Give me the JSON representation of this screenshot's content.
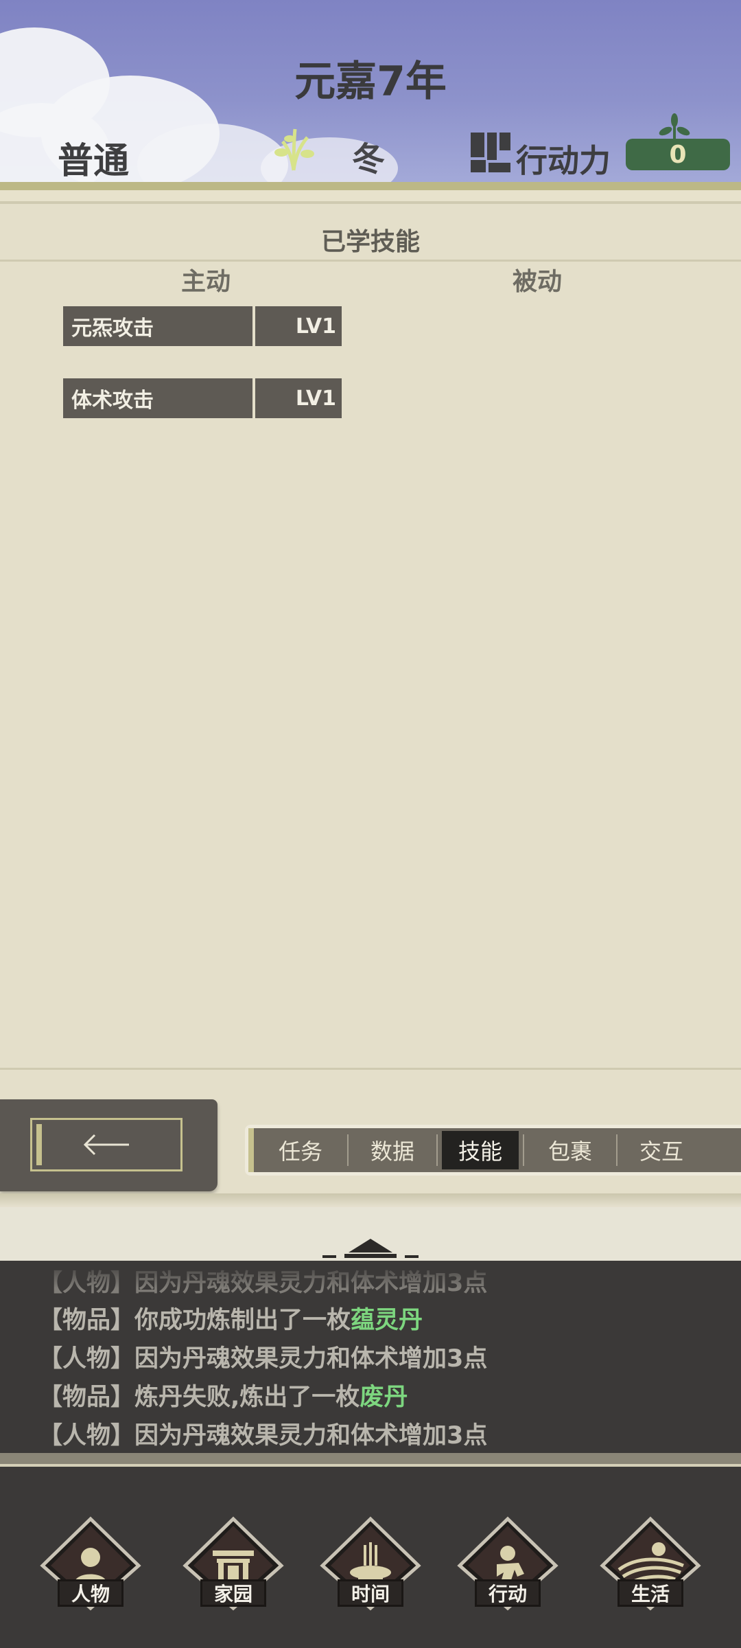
{
  "header": {
    "year_title": "元嘉7年",
    "difficulty": "普通",
    "season": "冬",
    "action_points_label": "行动力",
    "action_points_value": "0"
  },
  "skills_panel": {
    "title": "已学技能",
    "active_column": "主动",
    "passive_column": "被动",
    "active_skills": [
      {
        "name": "元炁攻击",
        "level": "LV1"
      },
      {
        "name": "体术攻击",
        "level": "LV1"
      }
    ]
  },
  "tabs": [
    {
      "label": "任务",
      "active": false
    },
    {
      "label": "数据",
      "active": false
    },
    {
      "label": "技能",
      "active": true
    },
    {
      "label": "包裹",
      "active": false
    },
    {
      "label": "交互",
      "active": false
    }
  ],
  "log": {
    "lines": [
      {
        "tag": "【人物】",
        "text": "因为丹魂效果灵力和体术增加3点",
        "highlight": ""
      },
      {
        "tag": "【物品】",
        "text": "你成功炼制出了一枚",
        "highlight": "蕴灵丹"
      },
      {
        "tag": "【人物】",
        "text": "因为丹魂效果灵力和体术增加3点",
        "highlight": ""
      },
      {
        "tag": "【物品】",
        "text": "炼丹失败,炼出了一枚",
        "highlight": "废丹"
      },
      {
        "tag": "【人物】",
        "text": "因为丹魂效果灵力和体术增加3点",
        "highlight": ""
      }
    ]
  },
  "nav": [
    {
      "label": "人物",
      "icon": "person-icon"
    },
    {
      "label": "家园",
      "icon": "gate-icon"
    },
    {
      "label": "时间",
      "icon": "incense-icon"
    },
    {
      "label": "行动",
      "icon": "action-icon"
    },
    {
      "label": "生活",
      "icon": "sunset-field-icon"
    }
  ],
  "colors": {
    "highlight": "#7dd67f",
    "action_points_box": "#3f6a46",
    "active_tab": "#232220"
  }
}
